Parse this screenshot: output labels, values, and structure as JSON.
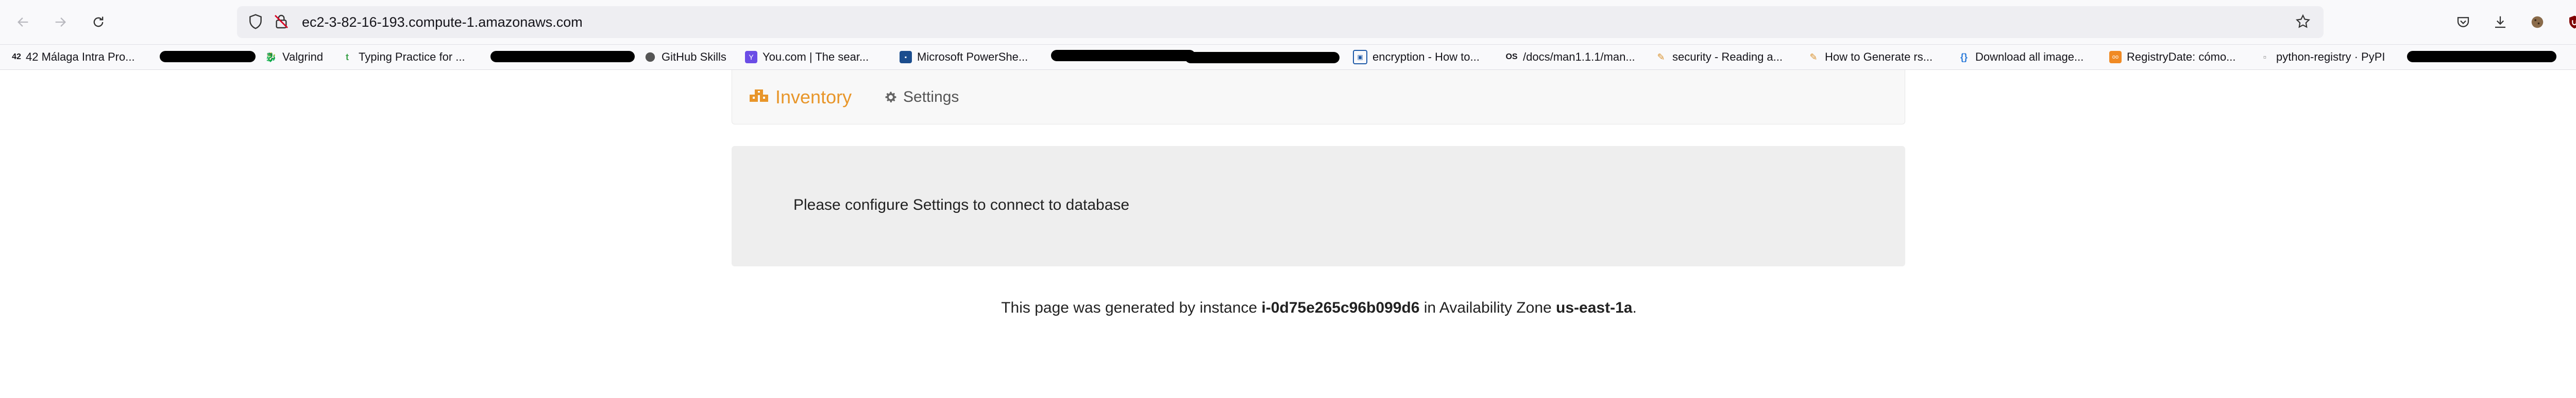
{
  "browser": {
    "url": "ec2-3-82-16-193.compute-1.amazonaws.com",
    "bookmarks": [
      "42 Málaga Intra Pro...",
      "Valgrind",
      "Typing Practice for ...",
      "GitHub Skills",
      "You.com | The sear...",
      "Microsoft PowerShe...",
      "encryption - How to...",
      "/docs/man1.1.1/man...",
      "security - Reading a...",
      "How to Generate rs...",
      "Download all image...",
      "RegistryDate: cómo...",
      "python-registry · PyPI"
    ]
  },
  "navbar": {
    "brand": "Inventory",
    "settings": "Settings"
  },
  "panel": {
    "message": "Please configure Settings to connect to database"
  },
  "footer": {
    "prefix": "This page was generated by instance ",
    "instance_id": "i-0d75e265c96b099d6",
    "middle": " in Availability Zone ",
    "zone": "us-east-1a",
    "suffix": "."
  },
  "colors": {
    "brand": "#e8962a",
    "panel_bg": "#eeeeee",
    "navbar_bg": "#f8f8f8"
  }
}
